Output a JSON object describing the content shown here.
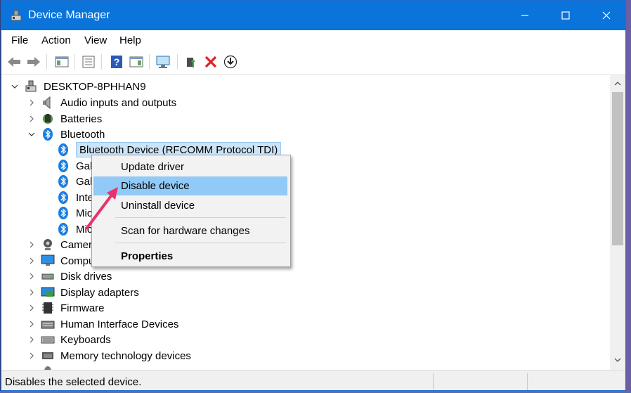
{
  "window": {
    "title": "Device Manager"
  },
  "title_buttons": [
    "minimize",
    "maximize",
    "close"
  ],
  "menu": [
    "File",
    "Action",
    "View",
    "Help"
  ],
  "toolbar_icons": [
    "back-arrow-icon",
    "forward-arrow-icon",
    "properties-pane-icon",
    "list-icon",
    "help-icon",
    "view-pane-icon",
    "monitor-scan-icon",
    "update-driver-icon",
    "uninstall-x-icon",
    "download-circle-icon"
  ],
  "tree": {
    "root": "DESKTOP-8PHHAN9",
    "categories": [
      "Audio inputs and outputs",
      "Batteries",
      "Bluetooth",
      "Camera",
      "Compu",
      "Disk drives",
      "Display adapters",
      "Firmware",
      "Human Interface Devices",
      "Keyboards",
      "Memory technology devices"
    ],
    "bluetooth_children": [
      "Bluetooth Device (RFCOMM Protocol TDI)",
      "Gal",
      "Gal",
      "Inte",
      "Mic",
      "Mic"
    ],
    "camera_partial": "Camera",
    "computer_partial": "Compu"
  },
  "context_menu": {
    "items": [
      "Update driver",
      "Disable device",
      "Uninstall device",
      "Scan for hardware changes",
      "Properties"
    ],
    "highlighted": "Disable device"
  },
  "status": {
    "text": "Disables the selected device."
  },
  "colors": {
    "titlebar": "#0a74da",
    "highlight": "#91c9f7",
    "selection": "#cce4f7",
    "arrow": "#e8336a"
  }
}
